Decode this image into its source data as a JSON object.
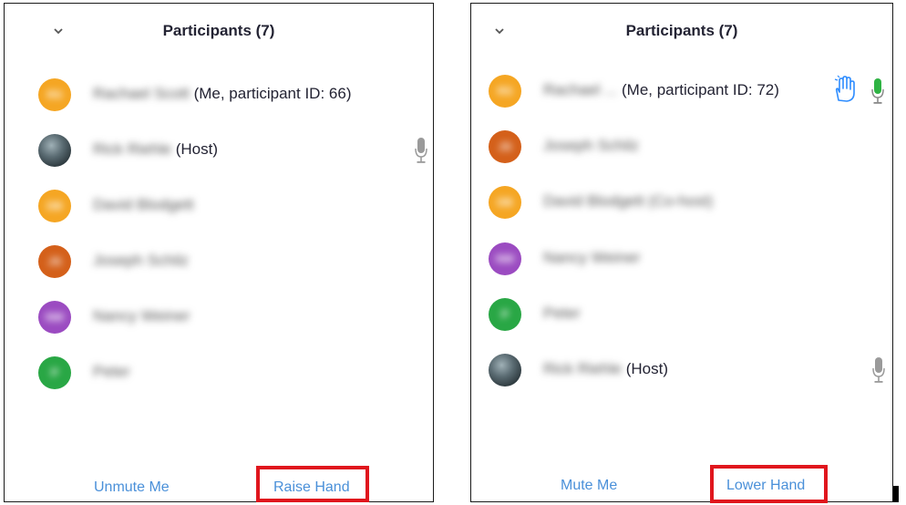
{
  "left_panel": {
    "title": "Participants (7)",
    "participants": [
      {
        "initials": "RS",
        "name": "Rachael Scott",
        "suffix": "(Me, participant ID: 66)",
        "color": "#f5a623"
      },
      {
        "initials": "",
        "name": "Rick Riehle",
        "suffix": "(Host)",
        "color": "#5f6f75",
        "mic": "microphone-icon"
      },
      {
        "initials": "DB",
        "name": "David Blodgett",
        "suffix": "",
        "color": "#f5a623"
      },
      {
        "initials": "JS",
        "name": "Joseph Schilz",
        "suffix": "",
        "color": "#d4601a"
      },
      {
        "initials": "NW",
        "name": "Nancy Weiner",
        "suffix": "",
        "color": "#9b4bc1"
      },
      {
        "initials": "P",
        "name": "Peter",
        "suffix": "",
        "color": "#29a745"
      }
    ],
    "footer": {
      "unmute_label": "Unmute Me",
      "raise_hand_label": "Raise Hand"
    }
  },
  "right_panel": {
    "title": "Participants (7)",
    "participants": [
      {
        "initials": "RS",
        "name": "Rachael ...",
        "suffix": "(Me, participant ID: 72)",
        "color": "#f5a623",
        "hand": "raised-hand-icon",
        "mic": "microphone-active-icon"
      },
      {
        "initials": "JS",
        "name": "Joseph Schilz",
        "suffix": "",
        "color": "#d4601a"
      },
      {
        "initials": "DB",
        "name": "David Blodgett (Co-host)",
        "suffix": "",
        "color": "#f5a623"
      },
      {
        "initials": "NW",
        "name": "Nancy Weiner",
        "suffix": "",
        "color": "#9b4bc1"
      },
      {
        "initials": "P",
        "name": "Peter",
        "suffix": "",
        "color": "#29a745"
      },
      {
        "initials": "",
        "name": "Rick Riehle",
        "suffix": "(Host)",
        "color": "#5f6f75",
        "mic": "microphone-icon"
      }
    ],
    "footer": {
      "mute_label": "Mute Me",
      "lower_hand_label": "Lower Hand"
    }
  },
  "colors": {
    "link": "#4a90d9",
    "highlight": "#e0161d",
    "mic_active": "#2fb344",
    "hand": "#2d8cff"
  }
}
